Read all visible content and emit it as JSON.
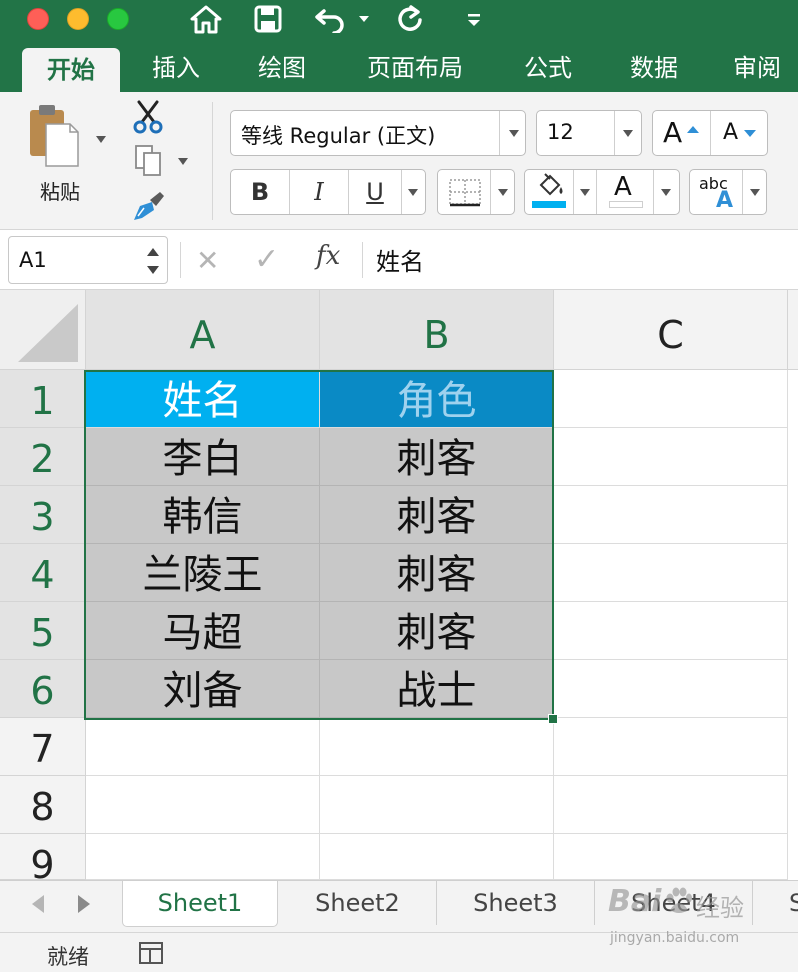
{
  "ribbon": {
    "tabs": [
      {
        "label": "开始",
        "active": true
      },
      {
        "label": "插入",
        "active": false
      },
      {
        "label": "绘图",
        "active": false
      },
      {
        "label": "页面布局",
        "active": false
      },
      {
        "label": "公式",
        "active": false
      },
      {
        "label": "数据",
        "active": false
      },
      {
        "label": "审阅",
        "active": false
      }
    ],
    "paste_label": "粘贴",
    "font_name": "等线 Regular (正文)",
    "font_size": "12",
    "bold_label": "B",
    "italic_label": "I",
    "underline_label": "U",
    "increase_font_label": "A",
    "decrease_font_label": "A",
    "font_color_label": "A",
    "orientation_label": "abc",
    "orientation_sub_label": "A",
    "accent_color": "#227447",
    "fill_color": "#00b0f0",
    "font_color": "#ffffff"
  },
  "formula_bar": {
    "cell_reference": "A1",
    "fx_label": "fx",
    "cancel_label": "✕",
    "confirm_label": "✓",
    "value": "姓名"
  },
  "sheet": {
    "columns": [
      "A",
      "B",
      "C"
    ],
    "rows": [
      "1",
      "2",
      "3",
      "4",
      "5",
      "6",
      "7",
      "8",
      "9"
    ],
    "selected_range": "A1:B6",
    "cells": [
      [
        "姓名",
        "角色"
      ],
      [
        "李白",
        "刺客"
      ],
      [
        "韩信",
        "刺客"
      ],
      [
        "兰陵王",
        "刺客"
      ],
      [
        "马超",
        "刺客"
      ],
      [
        "刘备",
        "战士"
      ]
    ],
    "header_fill_a": "#00b0f0",
    "header_fill_b": "#0a8ac5",
    "data_fill": "#c8c8c8"
  },
  "sheet_tabs": [
    {
      "label": "Sheet1",
      "active": true
    },
    {
      "label": "Sheet2",
      "active": false
    },
    {
      "label": "Sheet3",
      "active": false
    },
    {
      "label": "Sheet4",
      "active": false
    },
    {
      "label": "S",
      "active": false
    }
  ],
  "status": {
    "text": "就绪"
  },
  "watermark": {
    "brand": "Bai",
    "brand_suffix": "经验",
    "url": "jingyan.baidu.com"
  }
}
